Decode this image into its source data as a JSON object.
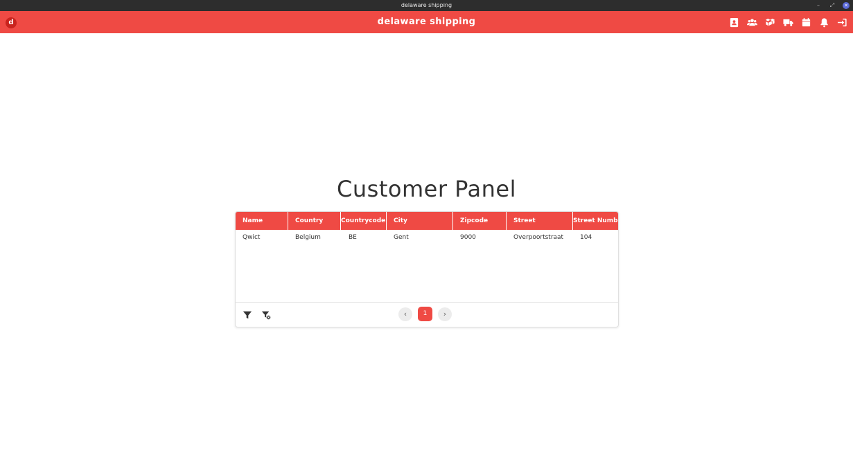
{
  "os": {
    "window_title": "delaware shipping",
    "minimize_icon": "minimize-icon",
    "maximize_icon": "maximize-icon",
    "close_icon": "close-icon"
  },
  "appbar": {
    "logo_letter": "d",
    "title": "delaware shipping",
    "background": "#ef4a44",
    "nav_icons": [
      "contact-card-icon",
      "users-icon",
      "boxes-icon",
      "truck-icon",
      "calendar-icon",
      "bell-icon",
      "logout-icon"
    ]
  },
  "page": {
    "title": "Customer Panel"
  },
  "grid": {
    "columns": [
      "Name",
      "Country",
      "Countrycode",
      "City",
      "Zipcode",
      "Street",
      "Street Number"
    ],
    "rows": [
      [
        "Qwict",
        "Belgium",
        "BE",
        "Gent",
        "9000",
        "Overpoortstraat",
        "104"
      ]
    ],
    "footer": {
      "filter_icon": "filter-icon",
      "clear_filter_icon": "clear-filter-icon",
      "prev_label": "‹",
      "next_label": "›",
      "current_page": "1"
    }
  }
}
